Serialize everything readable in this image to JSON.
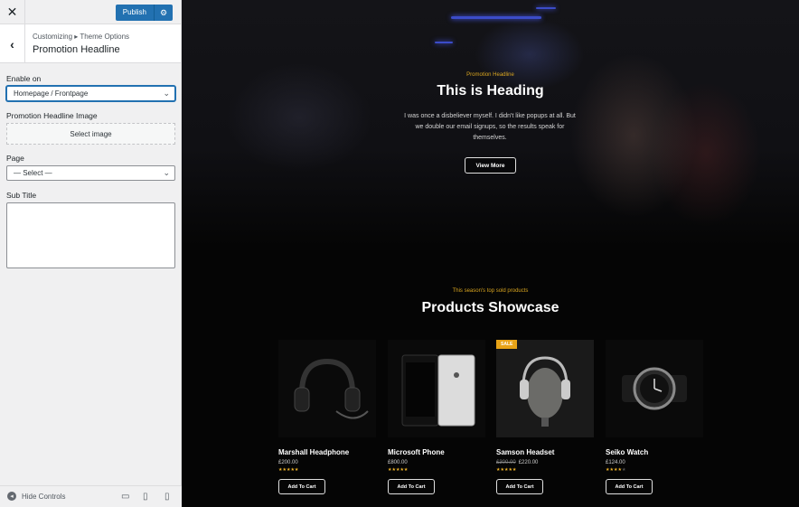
{
  "sidebar": {
    "close_icon": "close-icon",
    "publish_label": "Publish",
    "publish_gear_icon": "gear-icon",
    "back_icon": "chevron-left-icon",
    "breadcrumb": "Customizing ▸ Theme Options",
    "section_title": "Promotion Headline",
    "enable_on": {
      "label": "Enable on",
      "value": "Homepage / Frontpage"
    },
    "image": {
      "label": "Promotion Headline Image",
      "button": "Select image"
    },
    "page": {
      "label": "Page",
      "value": "— Select —"
    },
    "subtitle": {
      "label": "Sub Title",
      "value": ""
    },
    "footer": {
      "hide_controls": "Hide Controls"
    },
    "devices": [
      "desktop-icon",
      "tablet-icon",
      "mobile-icon"
    ]
  },
  "hero": {
    "tag": "Promotion Headline",
    "heading": "This is Heading",
    "text": "I was once a disbeliever myself. I didn't like popups at all. But we double our email signups, so the results speak for themselves.",
    "button": "View More"
  },
  "showcase": {
    "tag": "This season's top sold products",
    "heading": "Products Showcase",
    "products": [
      {
        "name": "Marshall Headphone",
        "price": "£200.00",
        "old_price": "",
        "rating": 5,
        "cart": "Add To Cart",
        "badge": ""
      },
      {
        "name": "Microsoft Phone",
        "price": "£800.00",
        "old_price": "",
        "rating": 5,
        "cart": "Add To Cart",
        "badge": ""
      },
      {
        "name": "Samson Headset",
        "price": "£220.00",
        "old_price": "£300.00",
        "rating": 5,
        "cart": "Add To Cart",
        "badge": "SALE"
      },
      {
        "name": "Seiko Watch",
        "price": "£124.00",
        "old_price": "",
        "rating": 4,
        "cart": "Add To Cart",
        "badge": ""
      }
    ]
  },
  "colors": {
    "accent": "#2271b1",
    "gold": "#d9a520",
    "star": "#f0b429"
  }
}
